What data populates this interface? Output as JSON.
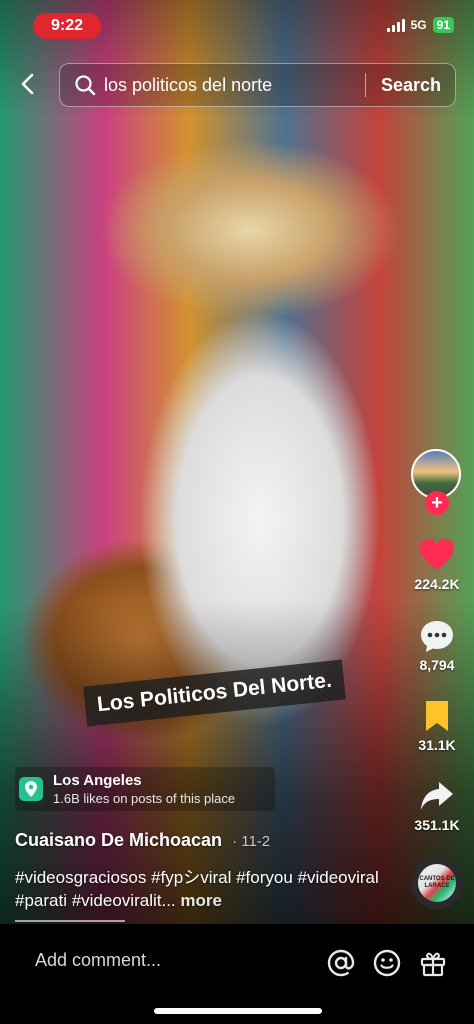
{
  "status_bar": {
    "time": "9:22",
    "network": "5G",
    "battery": "91"
  },
  "search": {
    "query": "los politicos del norte",
    "button_label": "Search"
  },
  "video": {
    "caption_overlay": "Los Politicos Del Norte."
  },
  "actions": {
    "likes": "224.2K",
    "comments": "8,794",
    "saves": "31.1K",
    "shares": "351.1K"
  },
  "location": {
    "name": "Los Angeles",
    "subtitle": "1.6B likes on posts of this place"
  },
  "post": {
    "author": "Cuaisano De Michoacan",
    "date": "· 11-2",
    "description": "#videosgraciosos #fypシviral #foryou #videoviral #parati #videoviralit...",
    "more_label": "more"
  },
  "music": {
    "disc_label": "CANTOS DE LARACE"
  },
  "colors": {
    "like": "#fe2c55",
    "save": "#fec32a",
    "follow": "#fe2c55",
    "location_icon": "#22c38e",
    "time_pill": "#e0272f"
  },
  "bottom": {
    "comment_placeholder": "Add comment..."
  }
}
